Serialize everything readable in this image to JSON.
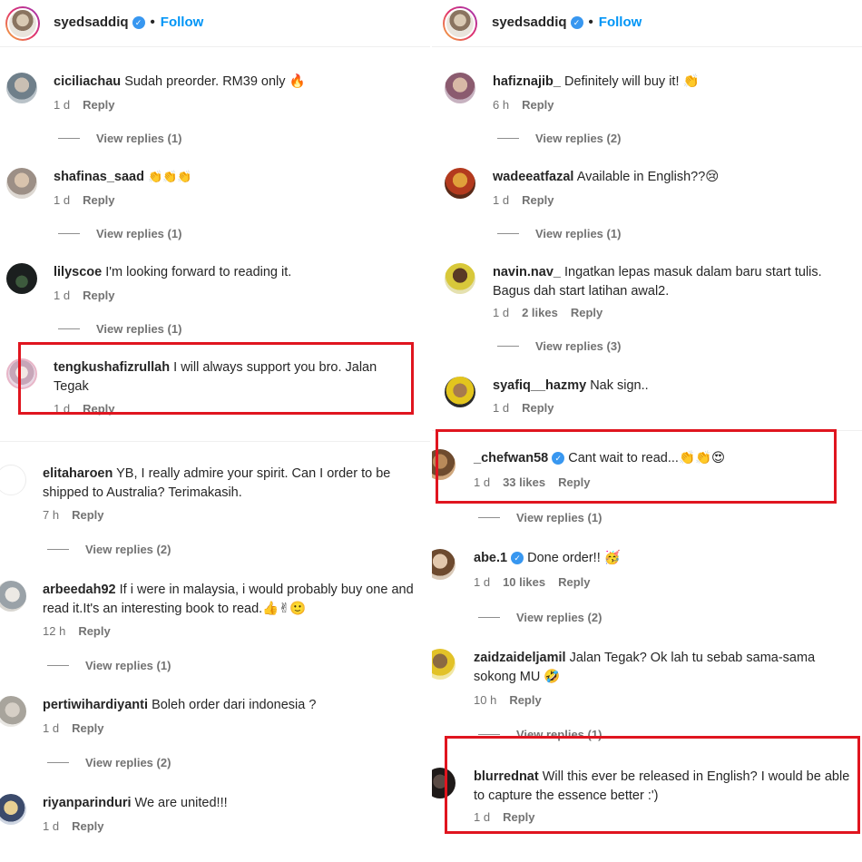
{
  "header": {
    "username": "syedsaddiq",
    "separator": "•",
    "follow_label": "Follow"
  },
  "left": {
    "comments": [
      {
        "user": "ciciliachau",
        "text": "Sudah preorder. RM39 only 🔥",
        "time": "1 d",
        "reply": "Reply",
        "view_replies": "View replies (1)"
      },
      {
        "user": "shafinas_saad",
        "text": "👏👏👏",
        "time": "1 d",
        "reply": "Reply",
        "view_replies": "View replies (1)"
      },
      {
        "user": "lilyscoe",
        "text": "I'm looking forward to reading it.",
        "time": "1 d",
        "reply": "Reply",
        "view_replies": "View replies (1)"
      },
      {
        "user": "tengkushafizrullah",
        "text": "I will always support you bro. Jalan Tegak",
        "time": "1 d",
        "reply": "Reply"
      },
      {
        "user": "elitaharoen",
        "text": "YB, I really admire your spirit. Can I order to be shipped to Australia? Terimakasih.",
        "time": "7 h",
        "reply": "Reply",
        "view_replies": "View replies (2)"
      },
      {
        "user": "arbeedah92",
        "text": "If i were in malaysia, i would probably buy one and read it.It's an interesting book to read.👍✌🙂",
        "time": "12 h",
        "reply": "Reply",
        "view_replies": "View replies (1)"
      },
      {
        "user": "pertiwihardiyanti",
        "text": "Boleh order dari indonesia ?",
        "time": "1 d",
        "reply": "Reply",
        "view_replies": "View replies (2)"
      },
      {
        "user": "riyanparinduri",
        "text": "We are united!!!",
        "time": "1 d",
        "reply": "Reply"
      }
    ]
  },
  "right": {
    "comments": [
      {
        "user": "hafiznajib_",
        "text": "Definitely will buy it! 👏",
        "time": "6 h",
        "reply": "Reply",
        "view_replies": "View replies (2)"
      },
      {
        "user": "wadeeatfazal",
        "text": "Available in English??😢",
        "time": "1 d",
        "reply": "Reply",
        "view_replies": "View replies (1)"
      },
      {
        "user": "navin.nav_",
        "text": "Ingatkan lepas masuk dalam baru start tulis. Bagus dah start latihan awal2.",
        "time": "1 d",
        "likes": "2 likes",
        "reply": "Reply",
        "view_replies": "View replies (3)"
      },
      {
        "user": "syafiq__hazmy",
        "text": "Nak sign..",
        "time": "1 d",
        "reply": "Reply"
      },
      {
        "user": "_chefwan58",
        "text": "Cant wait to read...👏👏😍",
        "time": "1 d",
        "likes": "33 likes",
        "reply": "Reply",
        "view_replies": "View replies (1)"
      },
      {
        "user": "abe.1",
        "text": "Done order!! 🥳",
        "time": "1 d",
        "likes": "10 likes",
        "reply": "Reply",
        "view_replies": "View replies (2)"
      },
      {
        "user": "zaidzaideljamil",
        "text": "Jalan Tegak? Ok lah tu sebab sama-sama sokong MU 🤣",
        "time": "10 h",
        "reply": "Reply",
        "view_replies": "View replies (1)"
      },
      {
        "user": "blurrednat",
        "text": "Will this ever be released in English? I would be able to capture the essence better :')",
        "time": "1 d",
        "reply": "Reply"
      }
    ]
  },
  "colors": {
    "highlight": "#e0151f",
    "follow": "#0095f6",
    "verified": "#3897f0"
  }
}
